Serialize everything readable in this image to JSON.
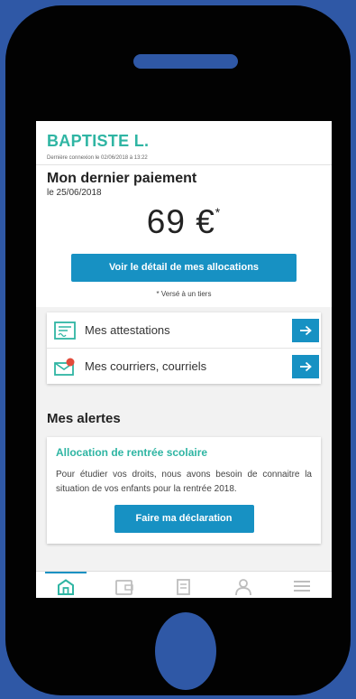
{
  "header": {
    "user_name": "BAPTISTE L.",
    "last_connection": "Dernière connexion le 02/06/2018 à 13:22"
  },
  "payment": {
    "title": "Mon dernier paiement",
    "date": "le 25/06/2018",
    "amount": "69 €",
    "amount_marker": "*",
    "detail_button": "Voir le détail de mes allocations",
    "note": "* Versé à un tiers"
  },
  "links": [
    {
      "label": "Mes attestations",
      "icon": "document-certificate-icon"
    },
    {
      "label": "Mes courriers, courriels",
      "icon": "envelope-notification-icon"
    }
  ],
  "alerts": {
    "title": "Mes alertes",
    "card_title": "Allocation de rentrée scolaire",
    "card_text": "Pour étudier vos droits, nous avons besoin de connaitre la situation de vos enfants pour la rentrée 2018.",
    "card_button": "Faire ma déclaration"
  },
  "tabbar": {
    "tabs": [
      "home-icon",
      "wallet-icon",
      "documents-icon",
      "profile-icon",
      "menu-icon"
    ],
    "active": 0
  },
  "colors": {
    "accent_teal": "#2fb5a3",
    "primary_blue": "#1791c3",
    "background_blue": "#2f58a6",
    "phone_body": "#020202"
  }
}
